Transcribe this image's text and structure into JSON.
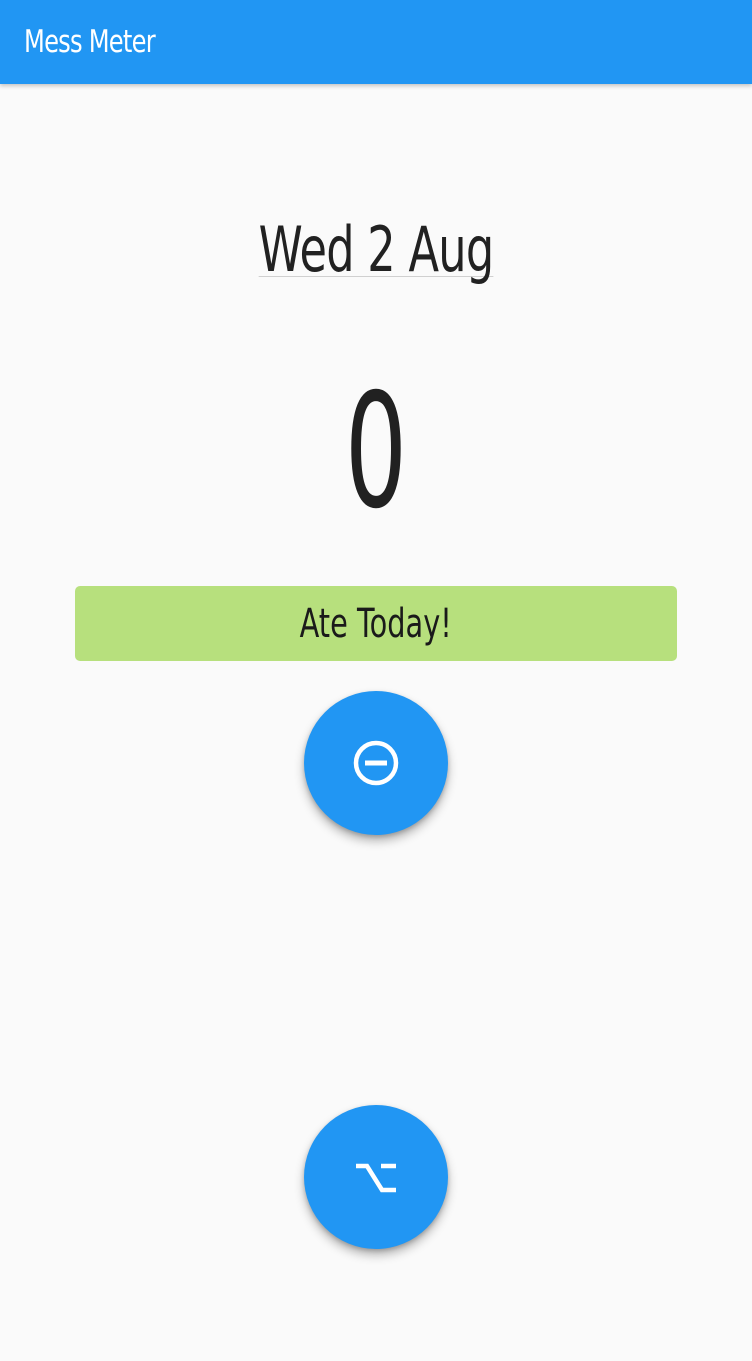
{
  "app_bar": {
    "title": "Mess Meter",
    "color": "#2196f3"
  },
  "main": {
    "date": "Wed 2 Aug",
    "count": "0",
    "ate_button": {
      "label": "Ate Today!",
      "color": "#b7e07d"
    },
    "decrement_button": {
      "icon": "remove-circle-outline-icon"
    },
    "option_button": {
      "icon": "option-key-icon"
    }
  }
}
